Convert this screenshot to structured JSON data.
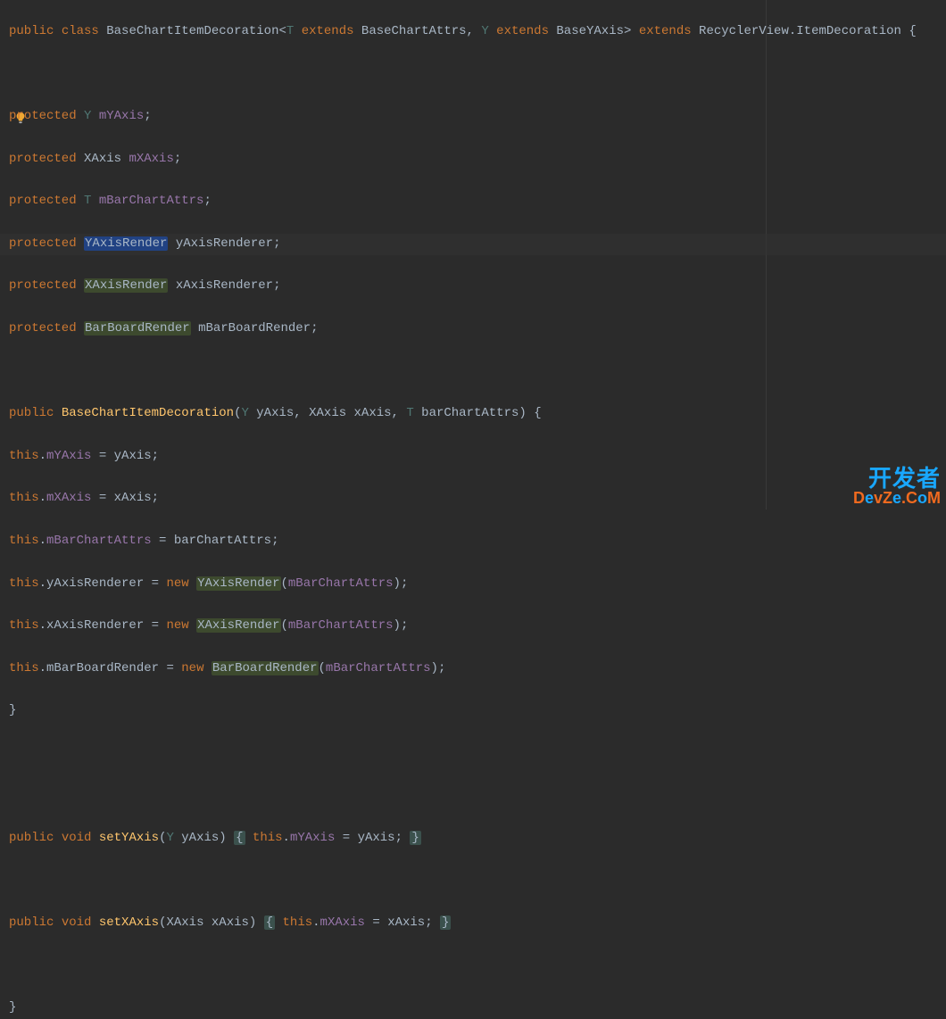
{
  "watermark": {
    "line1": "开发者",
    "line2a": "D",
    "line2b": "e",
    "line2c": "v",
    "line2d": "Z",
    "line2e": "e",
    "line2f": ".C",
    "line2g": "o",
    "line2h": "M"
  },
  "code": {
    "l1": {
      "kw1": "public",
      "kw2": "class",
      "cls": "BaseChartItemDecoration",
      "lt": "<",
      "T": "T",
      "ext1": "extends",
      "BCA": "BaseChartAttrs",
      "c1": ", ",
      "Y": "Y",
      "ext2": "extends",
      "BYA": "BaseYAxis",
      "gt": ">",
      "ext3": "extends",
      "RV": "RecyclerView",
      "dot": ".",
      "ID": "ItemDecoration",
      "ob": "{"
    },
    "l3": {
      "kw": "protected",
      "Y": "Y",
      "f": "mYAxis",
      "sc": ";"
    },
    "l4": {
      "kw": "protected",
      "t": "XAxis",
      "f": "mXAxis",
      "sc": ";"
    },
    "l5": {
      "kw": "protected",
      "T": "T",
      "f": "mBarChartAttrs",
      "sc": ";"
    },
    "l6": {
      "kw": "protected",
      "t": "YAxisRender",
      "v": "yAxisRenderer",
      "sc": ";"
    },
    "l7": {
      "kw": "protected",
      "t": "XAxisRender",
      "v": "xAxisRenderer",
      "sc": ";"
    },
    "l8": {
      "kw": "protected",
      "t": "BarBoardRender",
      "v": "mBarBoardRender",
      "sc": ";"
    },
    "l10": {
      "kw": "public",
      "ctor": "BaseChartItemDecoration",
      "op": "(",
      "Y": "Y",
      "p1": "yAxis",
      "c1": ", ",
      "Xt": "XAxis",
      "p2": "xAxis",
      "c2": ", ",
      "T": "T",
      "p3": "barChartAttrs",
      "cp": ")",
      "ob": "{"
    },
    "l11": {
      "this": "this",
      "dot": ".",
      "f": "mYAxis",
      "eq": " = ",
      "v": "yAxis",
      "sc": ";"
    },
    "l12": {
      "this": "this",
      "dot": ".",
      "f": "mXAxis",
      "eq": " = ",
      "v": "xAxis",
      "sc": ";"
    },
    "l13": {
      "this": "this",
      "dot": ".",
      "f": "mBarChartAttrs",
      "eq": " = ",
      "v": "barChartAttrs",
      "sc": ";"
    },
    "l14": {
      "this": "this",
      "dot": ".",
      "f": "yAxisRenderer",
      "eq": " = ",
      "new": "new",
      "t": "YAxisRender",
      "op": "(",
      "arg": "mBarChartAttrs",
      "cp": ")",
      "sc": ";"
    },
    "l15": {
      "this": "this",
      "dot": ".",
      "f": "xAxisRenderer",
      "eq": " = ",
      "new": "new",
      "t": "XAxisRender",
      "op": "(",
      "arg": "mBarChartAttrs",
      "cp": ")",
      "sc": ";"
    },
    "l16": {
      "this": "this",
      "dot": ".",
      "f": "mBarBoardRender",
      "eq": " = ",
      "new": "new",
      "t": "BarBoardRender",
      "op": "(",
      "arg": "mBarChartAttrs",
      "cp": ")",
      "sc": ";"
    },
    "l17": {
      "cb": "}"
    },
    "l20": {
      "kw": "public",
      "void": "void",
      "fn": "setYAxis",
      "op": "(",
      "Y": "Y",
      "p": "yAxis",
      "cp": ")",
      "ob": "{",
      "this": "this",
      "dot": ".",
      "f": "mYAxis",
      "eq": " = ",
      "v": "yAxis",
      "sc": ";",
      "cb": "}"
    },
    "l22": {
      "kw": "public",
      "void": "void",
      "fn": "setXAxis",
      "op": "(",
      "Xt": "XAxis",
      "p": "xAxis",
      "cp": ")",
      "ob": "{",
      "this": "this",
      "dot": ".",
      "f": "mXAxis",
      "eq": " = ",
      "v": "xAxis",
      "sc": ";",
      "cb": "}"
    },
    "l24": {
      "cb": "}"
    }
  }
}
